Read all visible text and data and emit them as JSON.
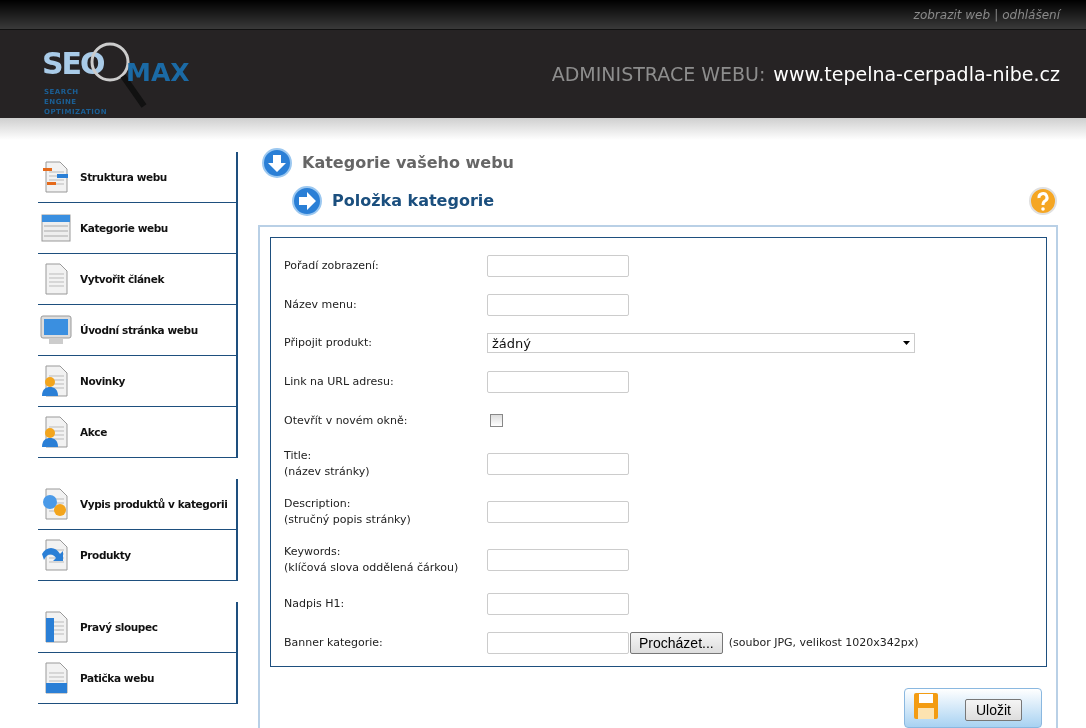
{
  "top_links": [
    "zobrazit web",
    "odhlášení"
  ],
  "top_separator": "|",
  "logo": {
    "seo": "SEO",
    "max": "MAX",
    "tagline": [
      "SEARCH",
      "ENGINE",
      "OPTIMIZATION"
    ]
  },
  "header": {
    "label": "ADMINISTRACE WEBU:",
    "site": "www.tepelna-cerpadla-nibe.cz"
  },
  "sidebar": {
    "groups": [
      {
        "items": [
          {
            "label": "Struktura webu"
          },
          {
            "label": "Kategorie webu"
          },
          {
            "label": "Vytvořit článek"
          },
          {
            "label": "Úvodní stránka webu"
          },
          {
            "label": "Novinky"
          },
          {
            "label": "Akce"
          }
        ]
      },
      {
        "items": [
          {
            "label": "Vypis produktů v kategorii"
          },
          {
            "label": "Produkty"
          }
        ]
      },
      {
        "items": [
          {
            "label": "Pravý sloupec"
          },
          {
            "label": "Patička webu"
          }
        ]
      }
    ]
  },
  "page_title": "Kategorie vašeho webu",
  "section_title": "Položka kategorie",
  "form": {
    "fields": [
      {
        "kind": "text",
        "label": "Pořadí zobrazení:"
      },
      {
        "kind": "text",
        "label": "Název menu:"
      },
      {
        "kind": "select",
        "label": "Připojit produkt:",
        "value": "žádný"
      },
      {
        "kind": "text",
        "label": "Link na URL adresu:"
      },
      {
        "kind": "checkbox",
        "label": "Otevřít v novém okně:",
        "checked": false
      },
      {
        "kind": "text",
        "label": "Title:",
        "hint": "(název stránky)"
      },
      {
        "kind": "text",
        "label": "Description:",
        "hint": "(stručný popis stránky)"
      },
      {
        "kind": "text",
        "label": "Keywords:",
        "hint": "(klíčová slova oddělená čárkou)"
      },
      {
        "kind": "text",
        "label": "Nadpis H1:"
      },
      {
        "kind": "file",
        "label": "Banner kategorie:",
        "button": "Procházet...",
        "note": "(soubor JPG, velikost 1020x342px)"
      }
    ]
  },
  "save_button": "Uložit"
}
